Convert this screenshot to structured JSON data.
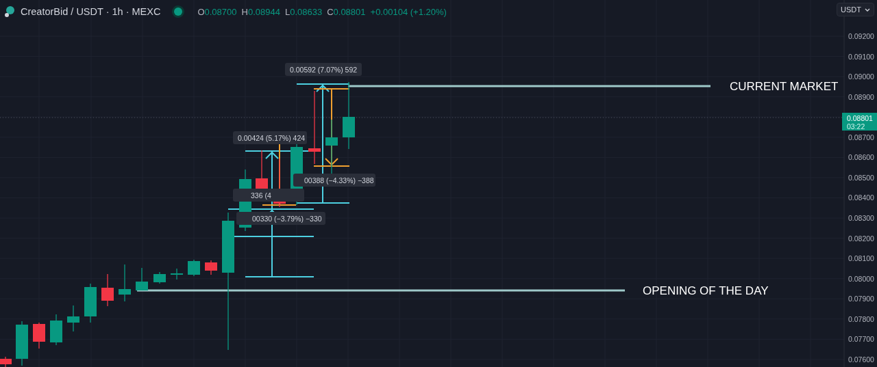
{
  "header": {
    "symbol": "CreatorBid / USDT · 1h · MEXC",
    "ohlc": [
      {
        "key": "O",
        "value": "0.08700"
      },
      {
        "key": "H",
        "value": "0.08944"
      },
      {
        "key": "L",
        "value": "0.08633"
      },
      {
        "key": "C",
        "value": "0.08801"
      }
    ],
    "change": "+0.00104 (+1.20%)"
  },
  "currency_button": {
    "label": "USDT"
  },
  "price_axis": {
    "ticks": [
      "0.09200",
      "0.09100",
      "0.09000",
      "0.08900",
      "0.08700",
      "0.08600",
      "0.08500",
      "0.08400",
      "0.08300",
      "0.08200",
      "0.08100",
      "0.08000",
      "0.07900",
      "0.07800",
      "0.07700",
      "0.07600"
    ],
    "last_price": "0.08801",
    "countdown": "03:22"
  },
  "notes": [
    {
      "text": "CURRENT MARKET"
    },
    {
      "text": "OPENING OF THE DAY"
    }
  ],
  "measurements": [
    {
      "kind": "rise",
      "text": "0.00592 (7.07%) 592"
    },
    {
      "kind": "fall",
      "text": "00388 (−4.33%) −388"
    },
    {
      "kind": "rise",
      "text": "0.00424 (5.17%) 424"
    },
    {
      "kind": "fall",
      "text": "336 (4"
    },
    {
      "kind": "rise",
      "text": "00330 (−3.79%) −330"
    }
  ]
}
